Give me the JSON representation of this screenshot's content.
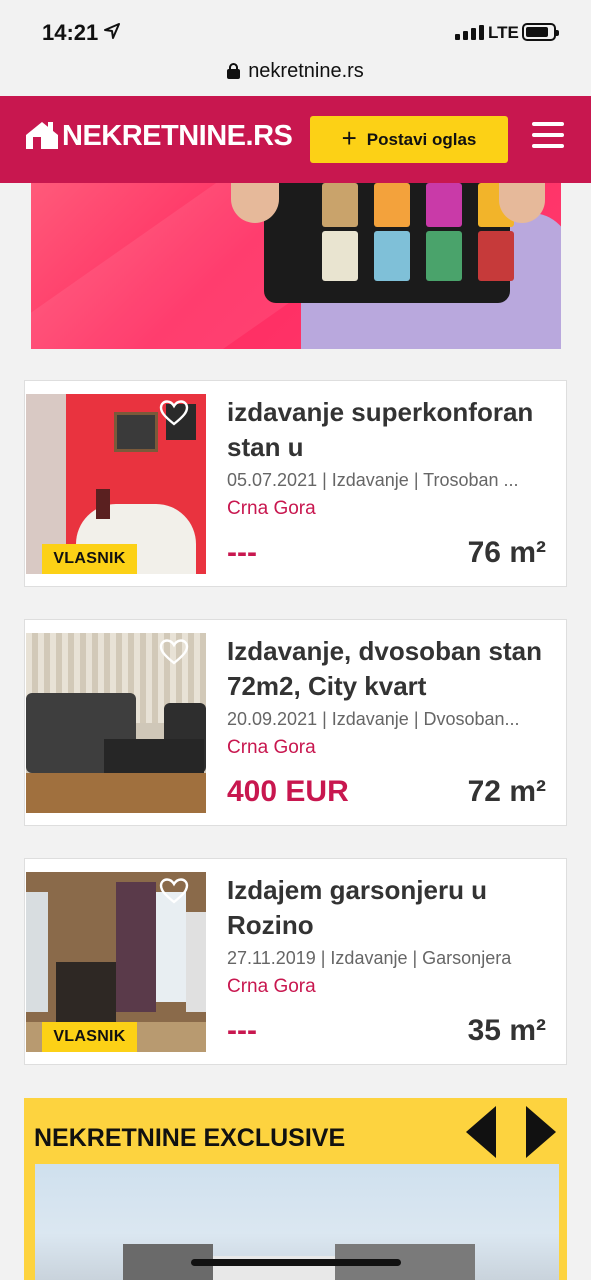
{
  "status_bar": {
    "time": "14:21",
    "network": "LTE"
  },
  "browser": {
    "url": "nekretnine.rs"
  },
  "header": {
    "logo_text": "NEKRETNINE.RS",
    "post_button_label": "Postavi oglas",
    "brand_color": "#c8174f",
    "accent_color": "#fcd116"
  },
  "listings": [
    {
      "title": "izdavanje superkonforan stan u",
      "meta": "05.07.2021 | Izdavanje | Trosoban ...",
      "location": "Crna Gora",
      "price": "---",
      "area": "76 m²",
      "badge": "VLASNIK"
    },
    {
      "title": "Izdavanje, dvosoban stan 72m2, City kvart",
      "meta": "20.09.2021 | Izdavanje | Dvosoban...",
      "location": "Crna Gora",
      "price": "400 EUR",
      "area": "72 m²",
      "badge": ""
    },
    {
      "title": "Izdajem garsonjeru u Rozino",
      "meta": "27.11.2019 | Izdavanje | Garsonjera",
      "location": "Crna Gora",
      "price": "---",
      "area": "35 m²",
      "badge": "VLASNIK"
    }
  ],
  "exclusive": {
    "title": "NEKRETNINE EXCLUSIVE"
  },
  "icons": [
    "location-arrow-icon",
    "signal-icon",
    "battery-icon",
    "lock-icon",
    "logo-house-icon",
    "plus-icon",
    "menu-icon",
    "heart-icon",
    "arrow-left-icon",
    "arrow-right-icon"
  ]
}
